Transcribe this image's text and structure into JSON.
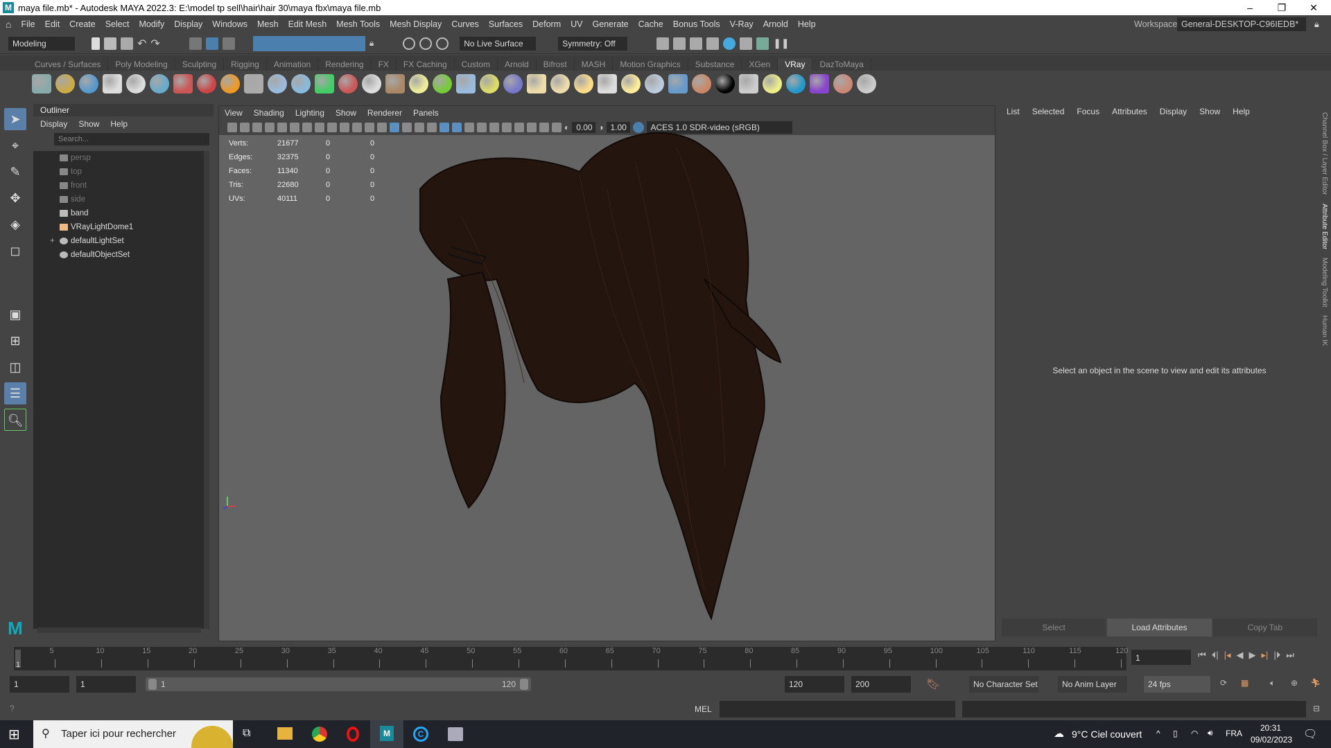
{
  "window": {
    "title": "maya file.mb* - Autodesk MAYA 2022.3: E:\\model tp sell\\hair\\hair 30\\maya fbx\\maya file.mb",
    "minimize": "–",
    "maximize": "❐",
    "close": "✕"
  },
  "menubar": [
    "File",
    "Edit",
    "Create",
    "Select",
    "Modify",
    "Display",
    "Windows",
    "Mesh",
    "Edit Mesh",
    "Mesh Tools",
    "Mesh Display",
    "Curves",
    "Surfaces",
    "Deform",
    "UV",
    "Generate",
    "Cache",
    "Bonus Tools",
    "V-Ray",
    "Arnold",
    "Help"
  ],
  "workspace": {
    "label": "Workspace:",
    "value": "General-DESKTOP-C96IEDB*"
  },
  "statusline": {
    "menuset": "Modeling",
    "live_surface": "No Live Surface",
    "symmetry": "Symmetry: Off"
  },
  "shelf_tabs": [
    "Curves / Surfaces",
    "Poly Modeling",
    "Sculpting",
    "Rigging",
    "Animation",
    "Rendering",
    "FX",
    "FX Caching",
    "Custom",
    "Arnold",
    "Bifrost",
    "MASH",
    "Motion Graphics",
    "Substance",
    "XGen",
    "VRay",
    "DazToMaya"
  ],
  "shelf_active": "VRay",
  "shelf_icons": [
    [
      "save-settings-icon",
      "#8aa"
    ],
    [
      "layer-icon",
      "#ca4"
    ],
    [
      "render-settings-icon",
      "#59c"
    ],
    [
      "plugin-icon",
      "#ddd"
    ],
    [
      "frame-buffer-icon",
      "#ddd"
    ],
    [
      "material-ball-icon",
      "#6ac"
    ],
    [
      "camera-icon",
      "#c55"
    ],
    [
      "spheres-icon",
      "#c44"
    ],
    [
      "fire-icon",
      "#e92"
    ],
    [
      "mesh-light-icon",
      "#aaa"
    ],
    [
      "sphere-light-icon",
      "#9bd"
    ],
    [
      "cone-icon",
      "#8bd"
    ],
    [
      "gradient-icon",
      "#4c6"
    ],
    [
      "proxy-icon",
      "#c55"
    ],
    [
      "disk-icon",
      "#ddd"
    ],
    [
      "wood-icon",
      "#a86"
    ],
    [
      "grid-sphere-icon",
      "#ee9"
    ],
    [
      "grass-icon",
      "#7c3"
    ],
    [
      "fur-icon",
      "#9bd"
    ],
    [
      "curve-icon",
      "#dd6"
    ],
    [
      "globe-icon",
      "#77c"
    ],
    [
      "dome-icon",
      "#eda"
    ],
    [
      "spot-light-icon",
      "#eda"
    ],
    [
      "light-ball-icon",
      "#fd8"
    ],
    [
      "ies-icon",
      "#ddd"
    ],
    [
      "sun-icon",
      "#fe9"
    ],
    [
      "plane-icon",
      "#bcd"
    ],
    [
      "ball-icon",
      "#69c"
    ],
    [
      "env-ball-icon",
      "#c86"
    ],
    [
      "checker-icon",
      "#000"
    ],
    [
      "vfb-icon",
      "#ccc"
    ],
    [
      "bulb-icon",
      "#ee8"
    ],
    [
      "cloud-icon",
      "#29c"
    ],
    [
      "palette-icon",
      "#84c"
    ],
    [
      "color-picker-icon",
      "#c87"
    ],
    [
      "help-icon",
      "#ccc"
    ]
  ],
  "outliner": {
    "title": "Outliner",
    "menu": [
      "Display",
      "Show",
      "Help"
    ],
    "search_placeholder": "Search...",
    "items": [
      {
        "label": "persp",
        "dim": true
      },
      {
        "label": "top",
        "dim": true
      },
      {
        "label": "front",
        "dim": true
      },
      {
        "label": "side",
        "dim": true
      },
      {
        "label": "band",
        "dim": false
      },
      {
        "label": "VRayLightDome1",
        "dim": false
      },
      {
        "label": "defaultLightSet",
        "dim": false,
        "expand": "+"
      },
      {
        "label": "defaultObjectSet",
        "dim": false
      }
    ]
  },
  "viewport": {
    "menu": [
      "View",
      "Shading",
      "Lighting",
      "Show",
      "Renderer",
      "Panels"
    ],
    "exposure": "0.00",
    "gamma": "1.00",
    "color_space": "ACES 1.0 SDR-video (sRGB)",
    "hud": [
      [
        "Verts:",
        "21677",
        "0",
        "0"
      ],
      [
        "Edges:",
        "32375",
        "0",
        "0"
      ],
      [
        "Faces:",
        "11340",
        "0",
        "0"
      ],
      [
        "Tris:",
        "22680",
        "0",
        "0"
      ],
      [
        "UVs:",
        "40111",
        "0",
        "0"
      ]
    ]
  },
  "attribute_editor": {
    "menu": [
      "List",
      "Selected",
      "Focus",
      "Attributes",
      "Display",
      "Show",
      "Help"
    ],
    "message": "Select an object in the scene to view and edit its attributes",
    "buttons": [
      "Select",
      "Load Attributes",
      "Copy Tab"
    ]
  },
  "right_tabs": [
    "Channel Box / Layer Editor",
    "Attribute Editor",
    "Modeling Toolkit",
    "Human IK"
  ],
  "timeline": {
    "ticks": [
      "5",
      "10",
      "15",
      "20",
      "25",
      "30",
      "35",
      "40",
      "45",
      "50",
      "55",
      "60",
      "65",
      "70",
      "75",
      "80",
      "85",
      "90",
      "95",
      "100",
      "105",
      "110",
      "115",
      "120"
    ],
    "current_frame": "1",
    "current_field": "1"
  },
  "range": {
    "start": "1",
    "playback_start": "1",
    "range_start": "1",
    "range_end": "120",
    "playback_end": "120",
    "end": "200",
    "character_set": "No Character Set",
    "anim_layer": "No Anim Layer",
    "fps": "24 fps"
  },
  "cmdline": {
    "lang": "MEL"
  },
  "taskbar": {
    "search": "Taper ici pour rechercher",
    "weather": "9°C  Ciel couvert",
    "lang": "FRA",
    "time": "20:31",
    "date": "09/02/2023"
  }
}
